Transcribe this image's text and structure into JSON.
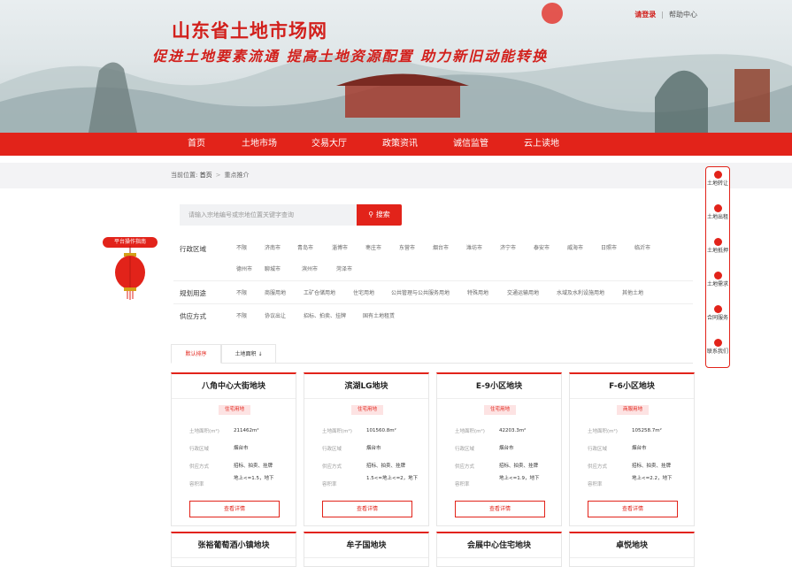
{
  "header": {
    "site_title": "山东省土地市场网",
    "slogan": "促进土地要素流通  提高土地资源配置  助力新旧动能转换",
    "login": "请登录",
    "help": "帮助中心"
  },
  "nav": [
    "首页",
    "土地市场",
    "交易大厅",
    "政策资讯",
    "诚信监管",
    "云上读地"
  ],
  "breadcrumb": {
    "prefix": "当前位置:",
    "home": "首页",
    "current": "重点推介"
  },
  "search": {
    "placeholder": "请输入宗地编号或宗地位置关键字查询",
    "button": "搜索"
  },
  "filters": {
    "region": {
      "label": "行政区域",
      "options": [
        "不限",
        "济南市",
        "青岛市",
        "淄博市",
        "枣庄市",
        "东营市",
        "烟台市",
        "潍坊市",
        "济宁市",
        "泰安市",
        "威海市",
        "日照市",
        "临沂市",
        "德州市",
        "聊城市",
        "滨州市",
        "菏泽市"
      ]
    },
    "usage": {
      "label": "规划用途",
      "options": [
        "不限",
        "商服用地",
        "工矿仓储用地",
        "住宅用地",
        "公共管理与公共服务用地",
        "特殊用地",
        "交通运输用地",
        "水域及水利设施用地",
        "其他土地"
      ]
    },
    "supply": {
      "label": "供应方式",
      "options": [
        "不限",
        "协议出让",
        "招标、拍卖、挂牌",
        "国有土地租赁"
      ]
    }
  },
  "guide": {
    "tag": "平台操作指南"
  },
  "side_panel": [
    "土地转让",
    "土地出租",
    "土地抵押",
    "土地需求",
    "合同服务",
    "联系我们"
  ],
  "tabs": [
    "默认排序",
    "土地面积 ↓"
  ],
  "card_labels": {
    "area": "土地面积(m²)",
    "region": "行政区域",
    "supply": "供应方式",
    "ratio": "容积率",
    "detail": "查看详情"
  },
  "cards": [
    {
      "title": "八角中心大街地块",
      "usage": "住宅用地",
      "area": "211462m²",
      "region": "烟台市",
      "supply": "招标、拍卖、挂牌",
      "ratio": "地上<=1.5，地下"
    },
    {
      "title": "滨湖LG地块",
      "usage": "住宅用地",
      "area": "101560.8m²",
      "region": "烟台市",
      "supply": "招标、拍卖、挂牌",
      "ratio": "1.5<=地上<=2，地下"
    },
    {
      "title": "E-9小区地块",
      "usage": "住宅用地",
      "area": "42203.3m²",
      "region": "烟台市",
      "supply": "招标、拍卖、挂牌",
      "ratio": "地上<=1.9，地下"
    },
    {
      "title": "F-6小区地块",
      "usage": "商服用地",
      "area": "105258.7m²",
      "region": "烟台市",
      "supply": "招标、拍卖、挂牌",
      "ratio": "地上<=2.2，地下"
    }
  ],
  "cards_row2": [
    "张裕葡萄酒小镇地块",
    "牟子国地块",
    "会展中心住宅地块",
    "卓悦地块"
  ],
  "colors": {
    "primary": "#e2231a",
    "badge_bg": "#fde3e3"
  }
}
